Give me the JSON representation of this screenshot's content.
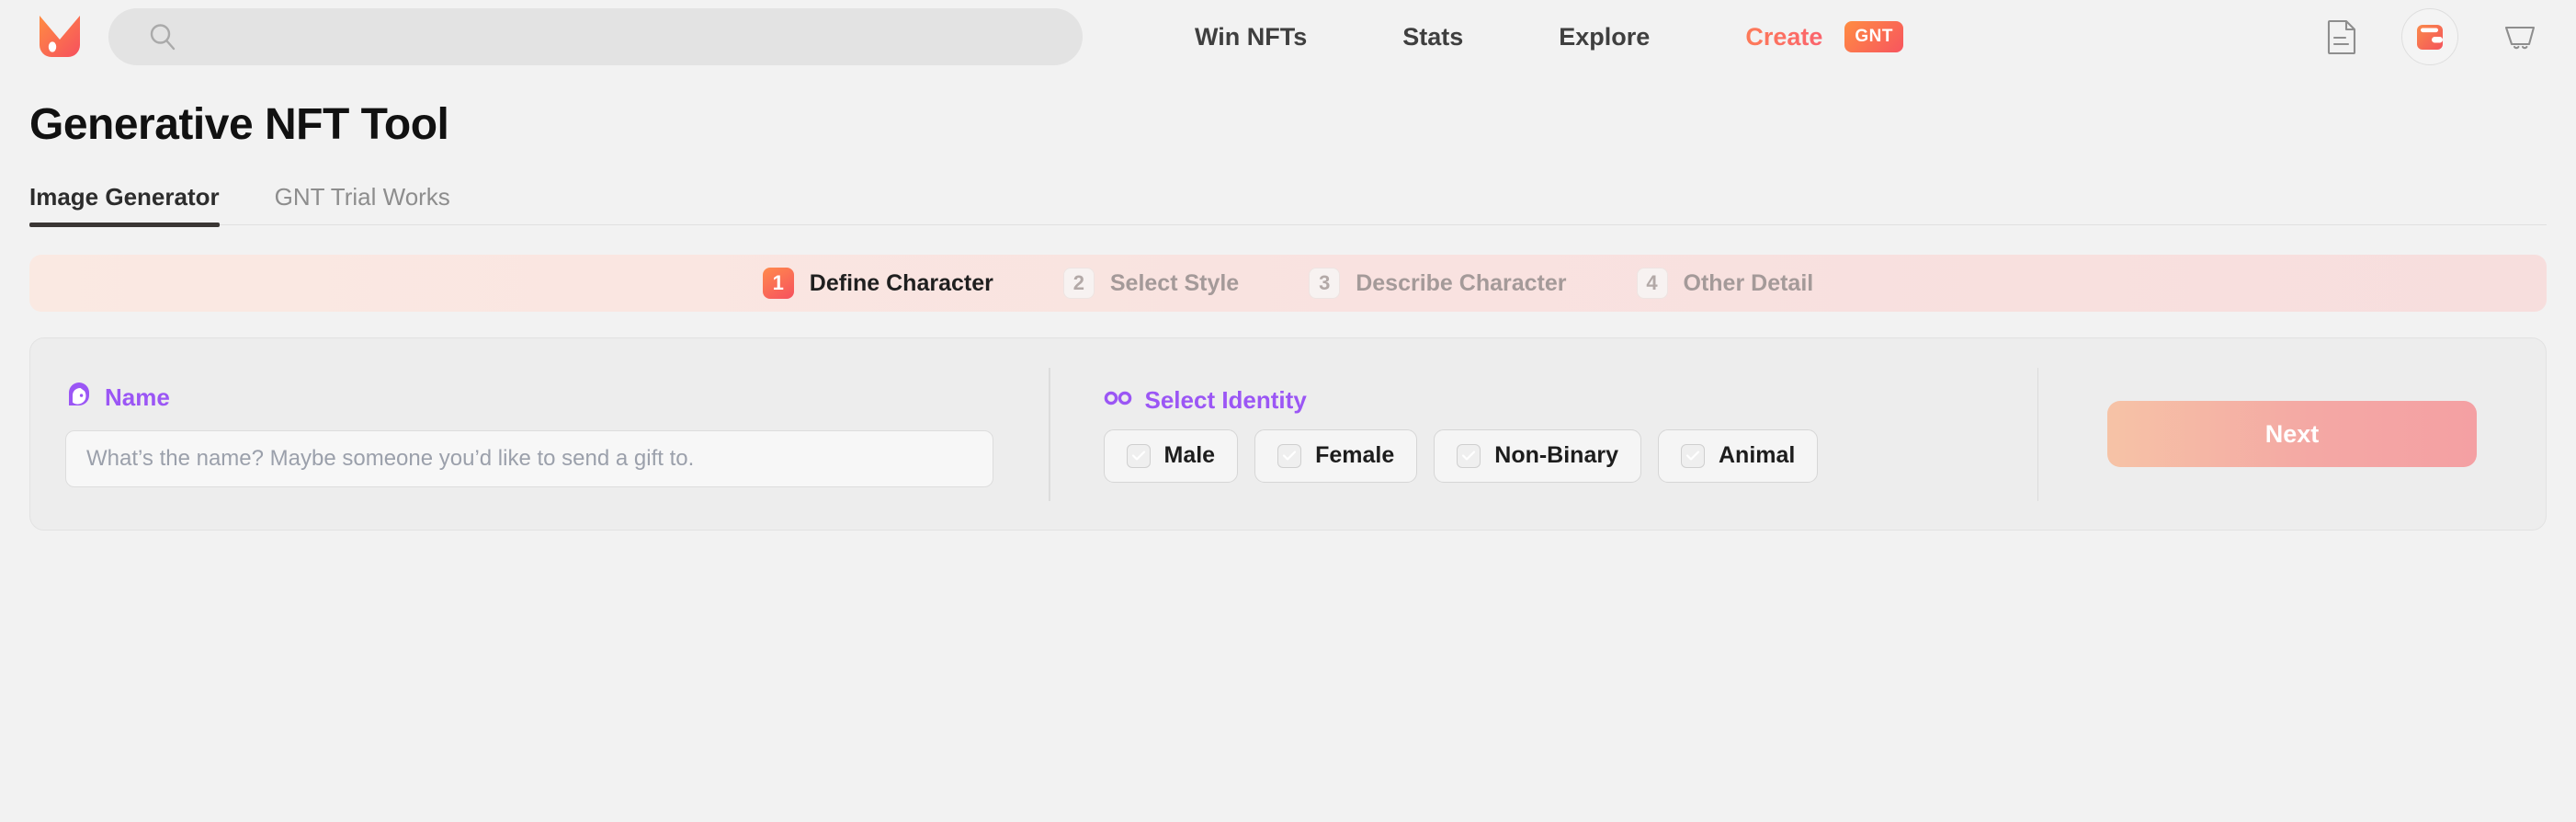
{
  "brand": {
    "logo_icon": "fox-head-logo",
    "accent_orange": "#ff8c42",
    "accent_red": "#f6505e",
    "accent_purple": "#9b56f5"
  },
  "header": {
    "search": {
      "icon": "search-icon",
      "value": "",
      "placeholder": ""
    },
    "nav": [
      {
        "label": "Win NFTs"
      },
      {
        "label": "Stats"
      },
      {
        "label": "Explore"
      }
    ],
    "create": {
      "label": "Create",
      "badge": "GNT"
    },
    "icons": [
      {
        "name": "document-icon"
      },
      {
        "name": "wallet-icon"
      },
      {
        "name": "cart-icon"
      }
    ]
  },
  "main": {
    "title": "Generative NFT Tool",
    "tabs": [
      {
        "label": "Image Generator",
        "active": true
      },
      {
        "label": "GNT Trial Works",
        "active": false
      }
    ],
    "stepper": [
      {
        "number": "1",
        "label": "Define Character",
        "active": true
      },
      {
        "number": "2",
        "label": "Select Style",
        "active": false
      },
      {
        "number": "3",
        "label": "Describe Character",
        "active": false
      },
      {
        "number": "4",
        "label": "Other Detail",
        "active": false
      }
    ],
    "form": {
      "name": {
        "icon": "avatar-icon",
        "label": "Name",
        "value": "",
        "placeholder": "What’s the name? Maybe someone you’d like to send a gift to."
      },
      "identity": {
        "icon": "infinity-icon",
        "label": "Select Identity",
        "options": [
          {
            "label": "Male",
            "checked": false
          },
          {
            "label": "Female",
            "checked": false
          },
          {
            "label": "Non-Binary",
            "checked": false
          },
          {
            "label": "Animal",
            "checked": false
          }
        ]
      },
      "next_label": "Next"
    }
  }
}
